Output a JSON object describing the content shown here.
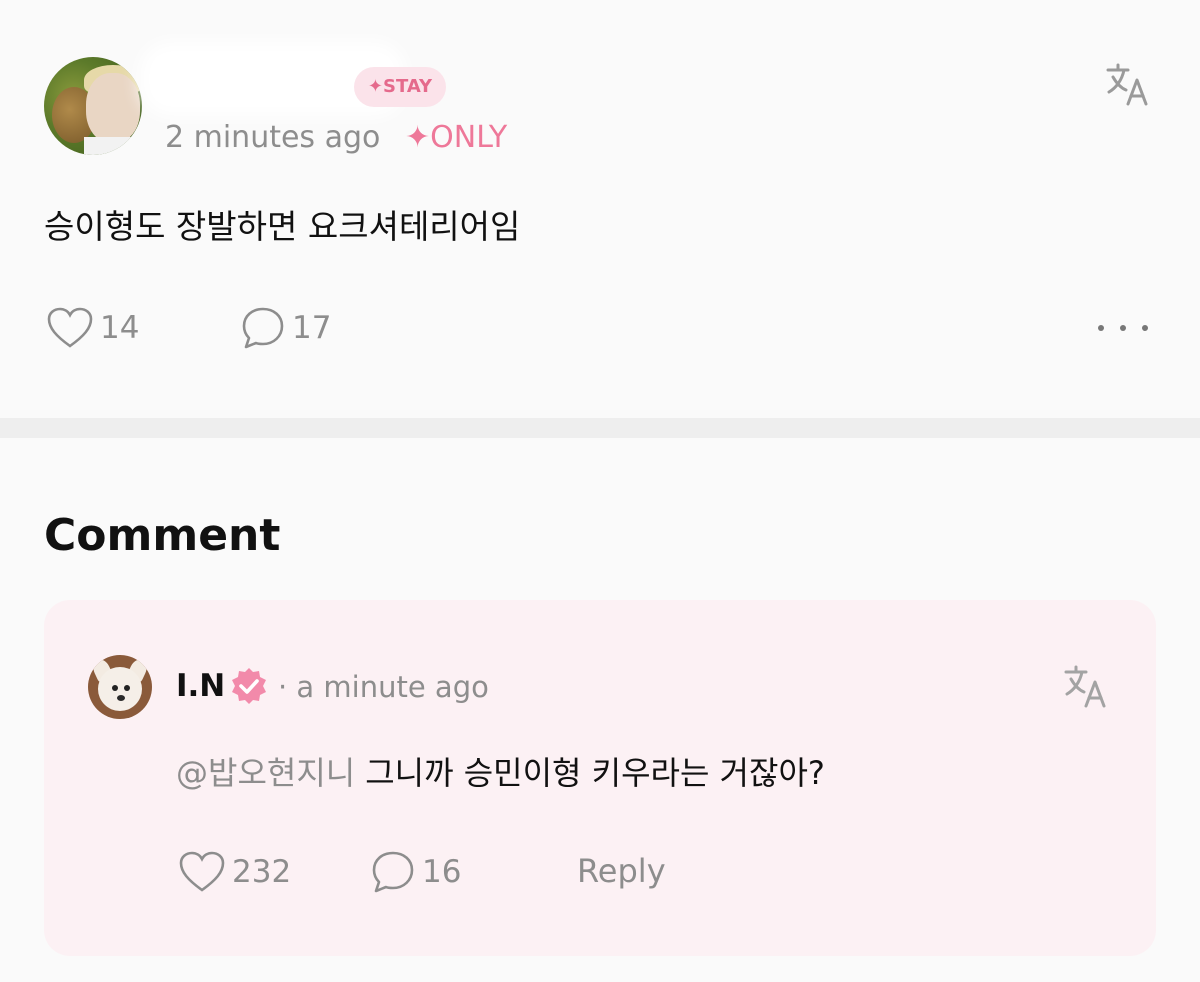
{
  "post": {
    "author_badge": "✦STAY",
    "time": "2 minutes ago",
    "audience_badge": "✦ONLY",
    "body": "승이형도 장발하면 요크셔테리어임",
    "like_count": "14",
    "comment_count": "17",
    "translate_icon": "translate-icon",
    "more_icon": "more-icon"
  },
  "comments": {
    "heading": "Comment",
    "items": [
      {
        "author": "I.N",
        "time": "· a minute ago",
        "mention": "@밥오현지니",
        "text": "그니까 승민이형 키우라는 거잖아?",
        "like_count": "232",
        "reply_count": "16",
        "reply_label": "Reply"
      }
    ]
  },
  "colors": {
    "accent_pink": "#ee7899",
    "badge_bg": "#fbe3ea",
    "card_bg": "#fcf1f4",
    "muted_text": "#8d8d8d"
  }
}
